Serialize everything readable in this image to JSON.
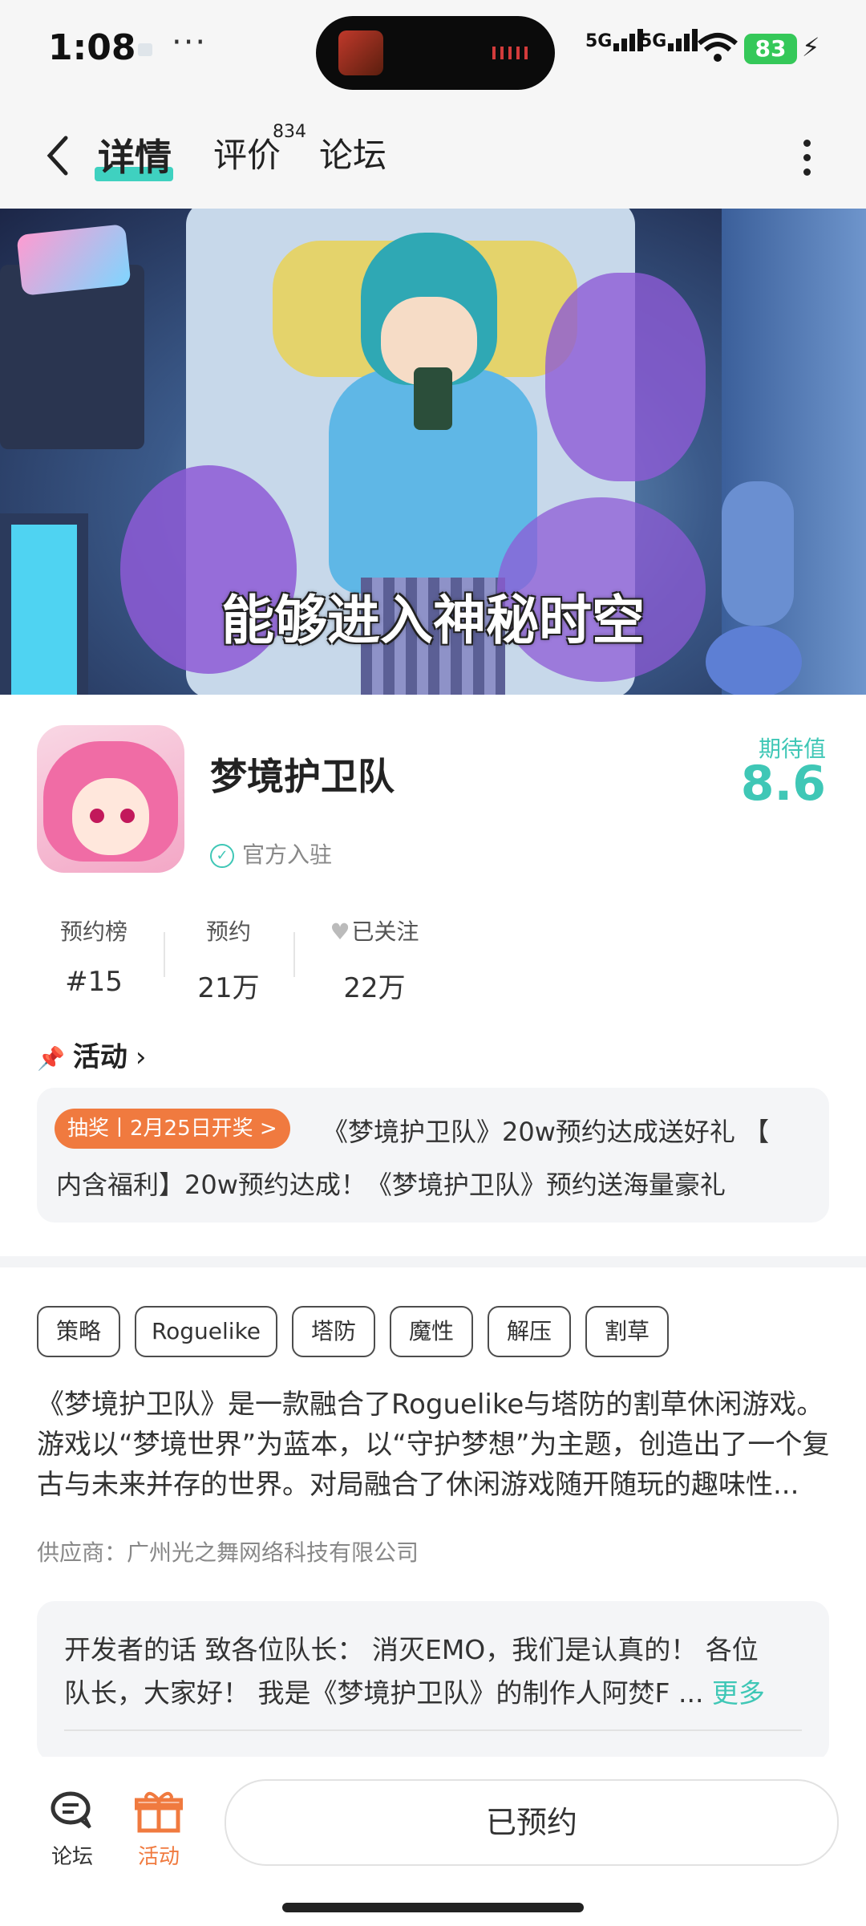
{
  "status_bar": {
    "time": "1:08",
    "dots": "···",
    "signal1": "5G",
    "signal2": "5G",
    "battery": "83",
    "icons": [
      "notification-icon",
      "signal-icon",
      "wifi-icon",
      "battery-icon",
      "charging-icon"
    ]
  },
  "nav": {
    "tabs": [
      {
        "label": "详情",
        "active": true
      },
      {
        "label": "评价",
        "count": "834"
      },
      {
        "label": "论坛"
      }
    ],
    "accent": "#3fd1c0"
  },
  "banner": {
    "caption": "能够进入神秘时空"
  },
  "game": {
    "name": "梦境护卫队",
    "verified": "官方入驻",
    "expect_label": "期待值",
    "expect_value": "8.6"
  },
  "stats": [
    {
      "label": "预约榜",
      "value": "#15"
    },
    {
      "label": "预约",
      "value": "21万"
    },
    {
      "label": "已关注",
      "value": "22万"
    }
  ],
  "activity": {
    "title": "活动",
    "tag": "抽奖丨2月25日开奖 >",
    "line1": "《梦境护卫队》20w预约达成送好礼 【",
    "line2": "内含福利】20w预约达成！《梦境护卫队》预约送海量豪礼"
  },
  "tags": [
    "策略",
    "Roguelike",
    "塔防",
    "魔性",
    "解压",
    "割草"
  ],
  "description": {
    "line1": "《梦境护卫队》是一款融合了Roguelike与塔防的割草休闲游戏。",
    "line2": "游戏以“梦境世界”为蓝本，以“守护梦想”为主题，创造出了一个复",
    "line3": "古与未来并存的世界。对局融合了休闲游戏随开随玩的趣味性..."
  },
  "supplier": "供应商：广州光之舞网络科技有限公司",
  "developer": {
    "text1": "开发者的话  致各位队长：  消灭EMO，我们是认真的！  各位",
    "text2": "队长，大家好！  我是《梦境护卫队》的制作人阿焚F ... ",
    "more": "更多"
  },
  "bottom_bar": {
    "forum_label": "论坛",
    "activity_label": "活动",
    "reserve_button": "已预约",
    "activity_color": "#f07a3f"
  }
}
